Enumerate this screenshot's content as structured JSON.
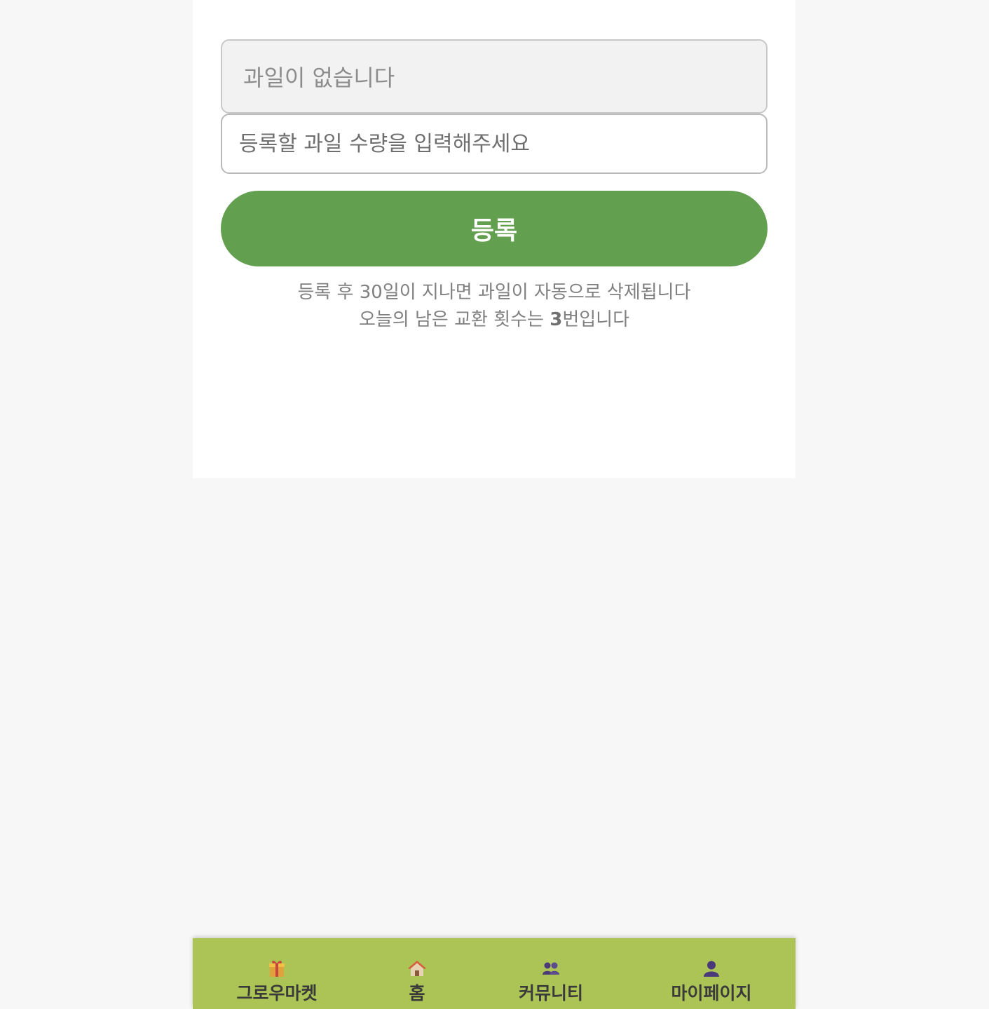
{
  "form": {
    "fruit_select_text": "과일이 없습니다",
    "quantity_placeholder": "등록할 과일 수량을 입력해주세요",
    "register_button": "등록",
    "info_line1": "등록 후 30일이 지나면 과일이 자동으로 삭제됩니다",
    "info_line2_prefix": "오늘의 남은 교환 횟수는 ",
    "info_line2_count": "3",
    "info_line2_suffix": "번입니다"
  },
  "nav": {
    "items": [
      {
        "label": "그로우마켓",
        "icon": "gift-icon"
      },
      {
        "label": "홈",
        "icon": "house-icon"
      },
      {
        "label": "커뮤니티",
        "icon": "people-icon"
      },
      {
        "label": "마이페이지",
        "icon": "person-icon"
      }
    ]
  },
  "colors": {
    "accent_green": "#629f4e",
    "nav_background": "#acc455",
    "page_background": "#f7f7f7"
  }
}
